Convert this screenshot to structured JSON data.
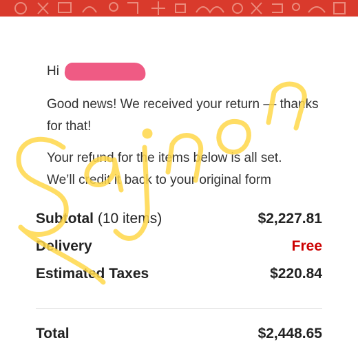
{
  "email": {
    "greeting": "Hi",
    "paragraph_1": "Good news! We received your return — thanks for that!",
    "paragraph_2_line_1": "Your refund for the items below is all set.",
    "paragraph_2_line_2": "We’ll credit it back to your original form"
  },
  "summary": {
    "subtotal_label": "Subtotal",
    "subtotal_count": " (10 items)",
    "subtotal_value": "$2,227.81",
    "delivery_label": "Delivery",
    "delivery_value": "Free",
    "taxes_label": "Estimated Taxes",
    "taxes_value": "$220.84",
    "total_label": "Total",
    "total_value": "$2,448.65"
  },
  "watermark": {
    "text": "Sajnon"
  },
  "colors": {
    "banner": "#d93a2c",
    "free": "#cc0000",
    "redaction": "#ef5b84",
    "watermark": "#ffd84a"
  }
}
